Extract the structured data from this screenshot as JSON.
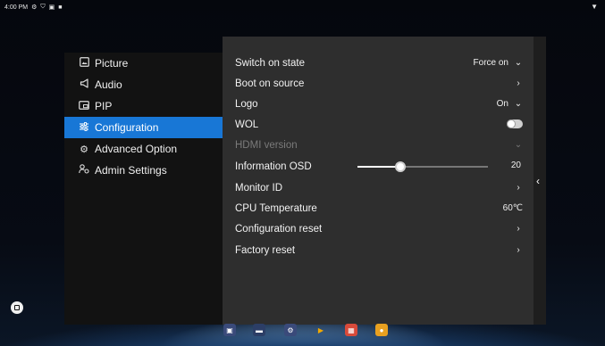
{
  "status_bar": {
    "time": "4:00 PM",
    "icons": [
      "settings-icon",
      "shield-icon",
      "notification-icon",
      "stop-icon"
    ],
    "wifi_icon": "wifi-icon"
  },
  "left_menu": {
    "items": [
      {
        "label": "Picture",
        "icon": "picture-icon",
        "active": false
      },
      {
        "label": "Audio",
        "icon": "speaker-icon",
        "active": false
      },
      {
        "label": "PIP",
        "icon": "pip-icon",
        "active": false
      },
      {
        "label": "Configuration",
        "icon": "sliders-icon",
        "active": true
      },
      {
        "label": "Advanced Option",
        "icon": "gear-icon",
        "active": false
      },
      {
        "label": "Admin Settings",
        "icon": "admin-icon",
        "active": false
      }
    ]
  },
  "right_menu": {
    "rows": [
      {
        "label": "Switch on state",
        "value": "Force on",
        "control": "dropdown"
      },
      {
        "label": "Boot on source",
        "value": "",
        "control": "arrow"
      },
      {
        "label": "Logo",
        "value": "On",
        "control": "dropdown"
      },
      {
        "label": "WOL",
        "value": "",
        "control": "toggle",
        "toggle_on": false
      },
      {
        "label": "HDMI version",
        "value": "",
        "control": "dropdown",
        "disabled": true
      },
      {
        "label": "Information OSD",
        "value": "20",
        "control": "slider",
        "slider_fraction": 0.33
      },
      {
        "label": "Monitor ID",
        "value": "",
        "control": "arrow"
      },
      {
        "label": "CPU Temperature",
        "value": "60℃",
        "control": "text"
      },
      {
        "label": "Configuration reset",
        "value": "",
        "control": "arrow"
      },
      {
        "label": "Factory reset",
        "value": "",
        "control": "arrow"
      }
    ]
  },
  "collapse_button": {
    "icon": "chevron-left-icon"
  },
  "home_button": {
    "icon": "home-icon"
  },
  "dock": {
    "apps": [
      {
        "icon": "media-player-icon",
        "color": "#3a4a7a"
      },
      {
        "icon": "folder-icon",
        "color": "#2c3e66"
      },
      {
        "icon": "settings-icon",
        "color": "#3a4a7a"
      },
      {
        "icon": "play-store-icon",
        "color": "#f2a900"
      },
      {
        "icon": "grid-app-icon",
        "color": "#d84a3a"
      },
      {
        "icon": "chrome-icon",
        "color": "#e8a020"
      }
    ]
  },
  "colors": {
    "accent": "#1877d6",
    "left_panel": "#121212",
    "right_panel": "#2e2e2e"
  }
}
